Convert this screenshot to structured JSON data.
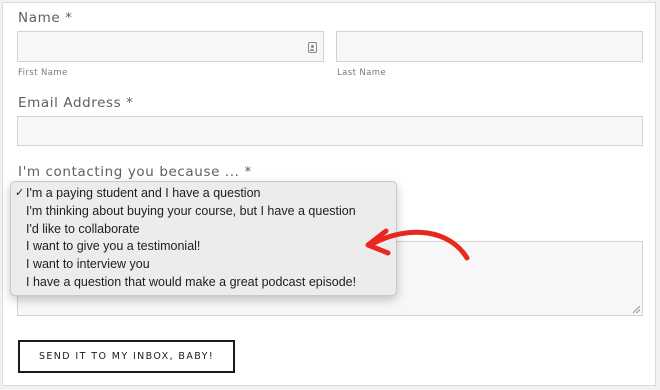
{
  "form": {
    "name_label": "Name *",
    "first_name_caption": "First Name",
    "last_name_caption": "Last Name",
    "email_label": "Email Address *",
    "contacting_label": "I'm contacting you because ... *",
    "submit_label": "SEND IT TO MY INBOX, BABY!"
  },
  "dropdown": {
    "selected_index": 0,
    "checkmark": "✓",
    "options": [
      "I'm a paying student and I have a question",
      "I'm thinking about buying your course, but I have a question",
      "I'd like to collaborate",
      "I want to give you a testimonial!",
      "I want to interview you",
      "I have a question that would make a great podcast episode!"
    ]
  },
  "annotation": {
    "arrow_color": "#e8281e",
    "icon": "red-arrow-icon"
  },
  "icons": {
    "first_name_field": "contact-card-icon"
  }
}
